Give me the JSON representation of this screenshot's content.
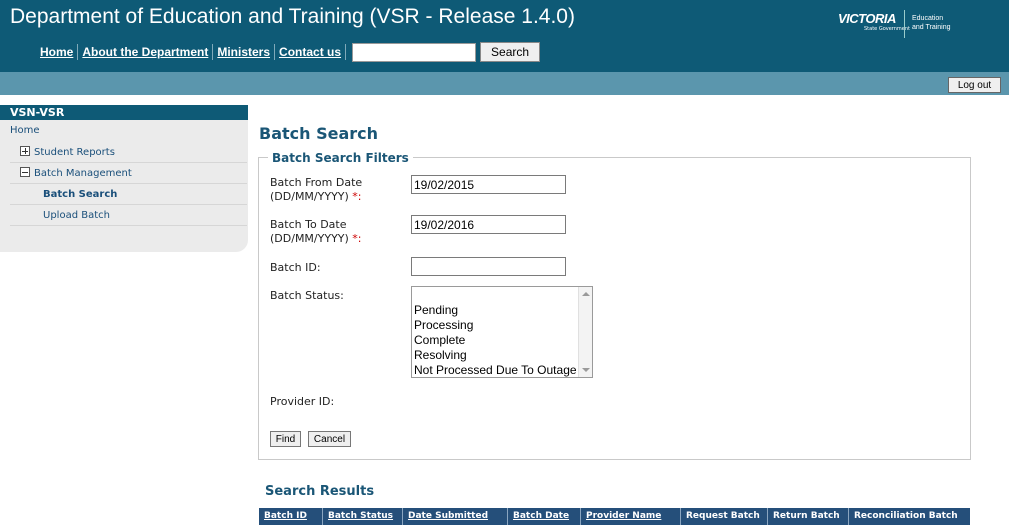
{
  "header": {
    "title": "Department of Education and Training (VSR - Release 1.4.0)",
    "nav": [
      "Home",
      "About the Department",
      "Ministers",
      "Contact us"
    ],
    "search_value": "",
    "search_button": "Search",
    "logo": {
      "mark": "VICTORIA",
      "sub": "State Government",
      "dept_line1": "Education",
      "dept_line2": "and Training"
    },
    "logout": "Log out"
  },
  "sidebar": {
    "title": "VSN-VSR",
    "home": "Home",
    "items": [
      {
        "label": "Student Reports",
        "expanded": false
      },
      {
        "label": "Batch Management",
        "expanded": true,
        "children": [
          "Batch Search",
          "Upload Batch"
        ]
      }
    ],
    "active": "Batch Search"
  },
  "main": {
    "title": "Batch Search",
    "filters": {
      "legend": "Batch Search Filters",
      "batch_from_label": "Batch From Date (DD/MM/YYYY)",
      "batch_from_value": "19/02/2015",
      "batch_to_label": "Batch To Date (DD/MM/YYYY)",
      "batch_to_value": "19/02/2016",
      "required_mark": "*:",
      "batch_id_label": "Batch ID:",
      "batch_id_value": "",
      "batch_status_label": "Batch Status:",
      "status_options": [
        "Pending",
        "Processing",
        "Complete",
        "Resolving",
        "Not Processed Due To Outage"
      ],
      "provider_id_label": "Provider ID:",
      "find_button": "Find",
      "cancel_button": "Cancel"
    },
    "results": {
      "title": "Search Results",
      "columns": [
        "Batch ID",
        "Batch Status",
        "Date Submitted",
        "Batch Date",
        "Provider Name",
        "Request Batch",
        "Return Batch",
        "Reconciliation Batch"
      ]
    }
  },
  "colors": {
    "header": "#0e5a76",
    "band": "#5b96ad",
    "accent": "#1a5676",
    "table_header": "#254f7a"
  }
}
